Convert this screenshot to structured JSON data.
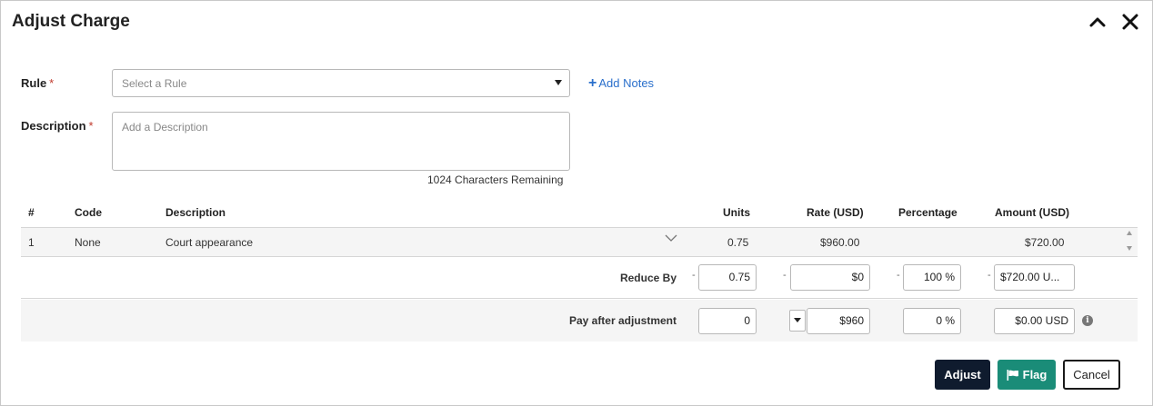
{
  "dialog": {
    "title": "Adjust Charge",
    "icons": {
      "collapse": "chevron-up-icon",
      "close": "close-icon"
    }
  },
  "form": {
    "rule_label": "Rule",
    "required_mark": "*",
    "rule_placeholder": "Select a Rule",
    "add_notes_label": "Add Notes",
    "description_label": "Description",
    "description_placeholder": "Add a Description",
    "chars_remaining": "1024 Characters Remaining"
  },
  "table": {
    "headers": {
      "num": "#",
      "code": "Code",
      "description": "Description",
      "units": "Units",
      "rate": "Rate (USD)",
      "percentage": "Percentage",
      "amount": "Amount (USD)"
    },
    "rows": [
      {
        "num": "1",
        "code": "None",
        "description": "Court appearance",
        "units": "0.75",
        "rate": "$960.00",
        "percentage": "",
        "amount": "$720.00"
      }
    ],
    "reduce_by": {
      "label": "Reduce By",
      "dash": "-",
      "units": "0.75",
      "rate": "$0",
      "percentage": "100 %",
      "amount": "$720.00 U..."
    },
    "pay_after": {
      "label": "Pay after adjustment",
      "units": "0",
      "rate": "$960",
      "percentage": "0 %",
      "amount": "$0.00 USD",
      "info_icon": "i"
    }
  },
  "actions": {
    "adjust": "Adjust",
    "flag": "Flag",
    "cancel": "Cancel"
  },
  "colors": {
    "accent_link": "#2a6fcb",
    "primary_button": "#0f1b2e",
    "flag_button": "#1a8c78",
    "required": "#c0392b"
  }
}
